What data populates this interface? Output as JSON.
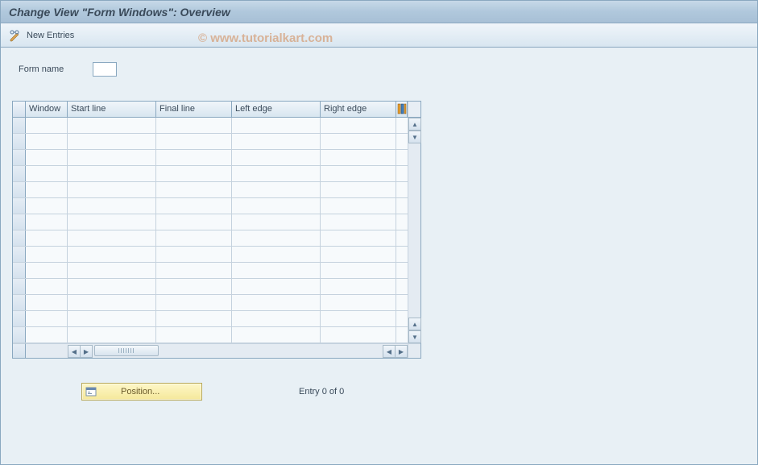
{
  "title": "Change View \"Form Windows\": Overview",
  "toolbar": {
    "new_entries_label": "New Entries"
  },
  "watermark": "© www.tutorialkart.com",
  "form": {
    "name_label": "Form name",
    "name_value": ""
  },
  "table": {
    "columns": {
      "window": "Window",
      "start_line": "Start line",
      "final_line": "Final line",
      "left_edge": "Left edge",
      "right_edge": "Right edge"
    },
    "row_count": 14
  },
  "footer": {
    "position_label": "Position...",
    "entry_label": "Entry 0 of 0"
  }
}
